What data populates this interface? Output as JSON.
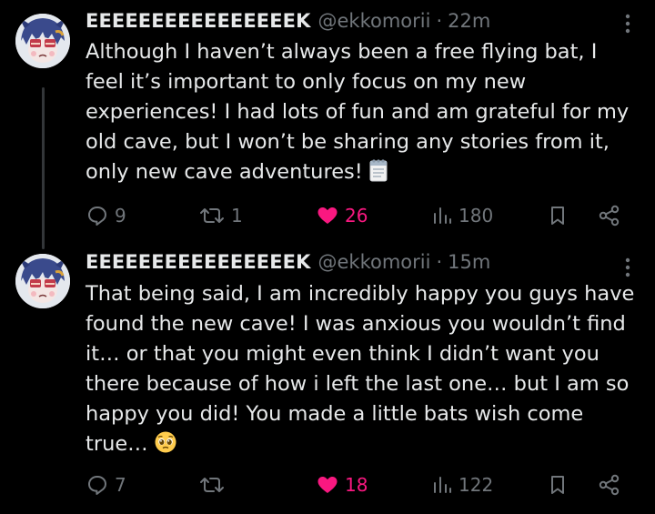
{
  "tweets": [
    {
      "display_name": "EEEEEEEEEEEEEEEEK",
      "handle": "@ekkomorii",
      "separator": "·",
      "time": "22m",
      "lines": [
        "Although I haven’t always been a free flying bat, I",
        "feel it’s important to only focus on my new",
        "experiences! I had lots of fun and am grateful for my",
        "old cave, but I won’t be sharing any stories from it,",
        "only new cave adventures!"
      ],
      "trailing_emoji": "notepad-emoji",
      "replies": "9",
      "reposts": "1",
      "likes": "26",
      "views": "180",
      "liked": true
    },
    {
      "display_name": "EEEEEEEEEEEEEEEEK",
      "handle": "@ekkomorii",
      "separator": "·",
      "time": "15m",
      "lines": [
        "That being said, I am incredibly happy you guys have",
        "found the new cave! I was anxious you wouldn’t find",
        "it… or that you might even think I didn’t want you",
        "there because of how i left the last one… but I am so",
        "happy you did! You made a little bats wish come",
        "true…"
      ],
      "trailing_emoji": "pleading-face-emoji",
      "replies": "7",
      "reposts": "",
      "likes": "18",
      "views": "122",
      "liked": true
    }
  ],
  "colors": {
    "background": "#000000",
    "text": "#e7e9ea",
    "muted": "#71767b",
    "like": "#f91880",
    "thread_line": "#333639"
  }
}
